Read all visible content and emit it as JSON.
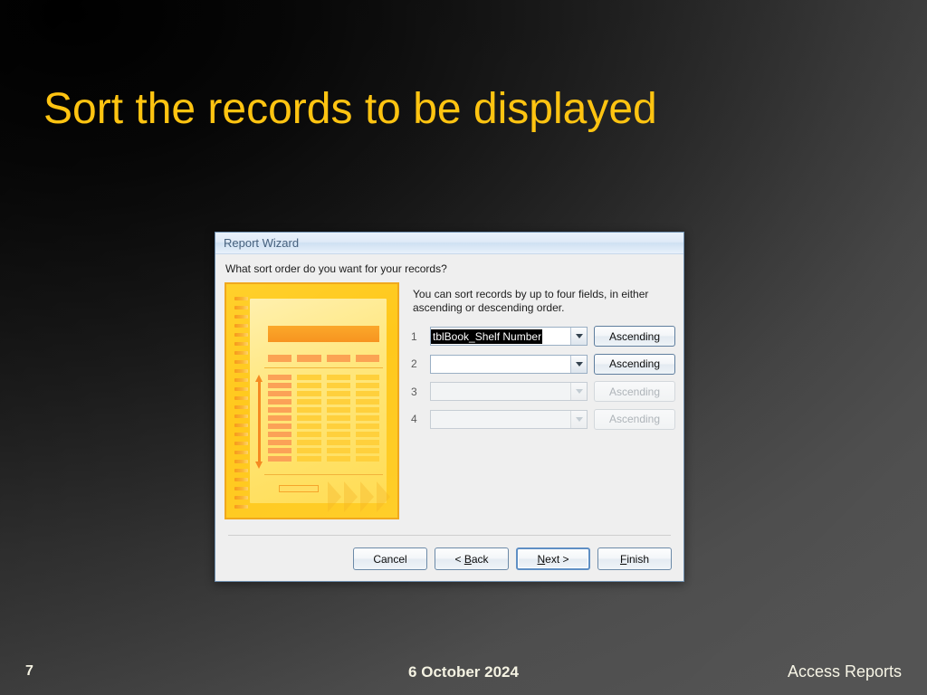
{
  "slide": {
    "title": "Sort the records to be displayed",
    "title_color": "#FFC411",
    "footer": {
      "slide_number": "7",
      "date": "6 October 2024",
      "subject": "Access Reports"
    }
  },
  "dialog": {
    "title": "Report Wizard",
    "question": "What sort order do you want for your records?",
    "hint": "You can sort records by up to four fields, in either ascending or descending order.",
    "sort_rows": [
      {
        "number": "1",
        "field": "tblBook_Shelf Number",
        "field_selected": true,
        "enabled": true,
        "order_label": "Ascending"
      },
      {
        "number": "2",
        "field": "",
        "field_selected": false,
        "enabled": true,
        "order_label": "Ascending"
      },
      {
        "number": "3",
        "field": "",
        "field_selected": false,
        "enabled": false,
        "order_label": "Ascending"
      },
      {
        "number": "4",
        "field": "",
        "field_selected": false,
        "enabled": false,
        "order_label": "Ascending"
      }
    ],
    "buttons": {
      "cancel": "Cancel",
      "back_prefix": "< ",
      "back_accel": "B",
      "back_rest": "ack",
      "next_accel": "N",
      "next_rest": "ext >",
      "finish_accel": "F",
      "finish_rest": "inish"
    },
    "preview": {
      "alt": "report-sort-preview"
    }
  }
}
